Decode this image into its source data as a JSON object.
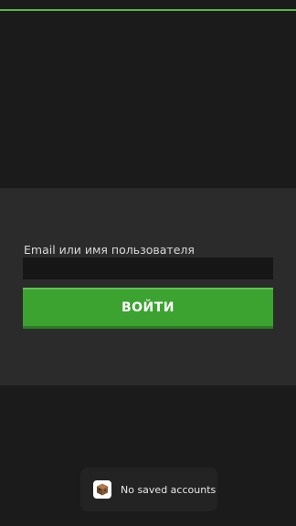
{
  "login": {
    "field_label": "Email или имя пользователя",
    "input_value": "",
    "input_placeholder": "",
    "button_label": "ВОЙТИ"
  },
  "toast": {
    "icon": "app-cube-icon",
    "message": "No saved accounts"
  },
  "colors": {
    "background": "#1b1b1b",
    "panel": "#2b2b2b",
    "accent_green": "#3ca331",
    "input_background": "#161616"
  }
}
